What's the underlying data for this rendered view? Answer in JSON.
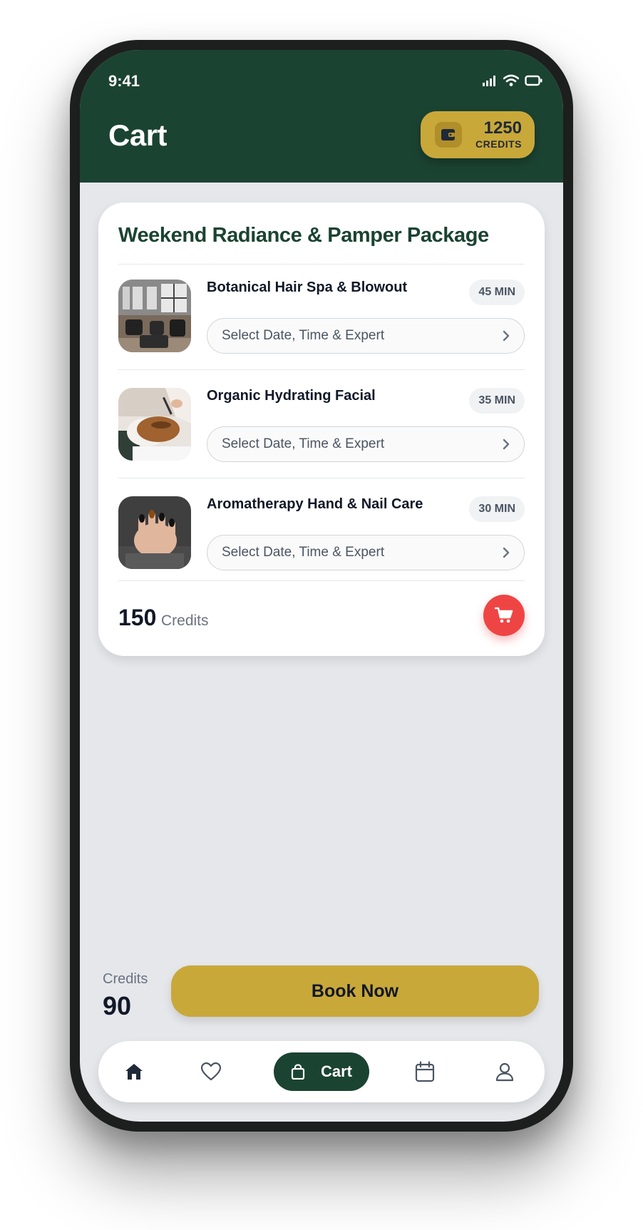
{
  "status_bar": {
    "time": "9:41"
  },
  "header": {
    "title": "Cart",
    "wallet": {
      "amount": "1250",
      "unit_label": "CREDITS"
    }
  },
  "package": {
    "title": "Weekend Radiance & Pamper Package",
    "services": [
      {
        "name": "Botanical Hair Spa & Blowout",
        "duration": "45 MIN",
        "select_label": "Select Date, Time & Expert"
      },
      {
        "name": "Organic Hydrating Facial",
        "duration": "35 MIN",
        "select_label": "Select Date, Time & Expert"
      },
      {
        "name": "Aromatherapy Hand & Nail Care",
        "duration": "30 MIN",
        "select_label": "Select Date, Time & Expert"
      }
    ],
    "total_amount": "150",
    "total_label": "Credits"
  },
  "footer": {
    "credits_label": "Credits",
    "credits_value": "90",
    "book_button_label": "Book Now"
  },
  "bottom_nav": {
    "items": [
      {
        "icon": "home-icon"
      },
      {
        "icon": "heart-icon"
      },
      {
        "icon": "shopping-bag-icon",
        "label": "Cart",
        "active": true
      },
      {
        "icon": "calendar-icon"
      },
      {
        "icon": "user-icon"
      }
    ]
  },
  "colors": {
    "primary_green": "#1b4332",
    "gold": "#c9a83a",
    "cart_red": "#ef4444",
    "background": "#e5e7eb"
  }
}
